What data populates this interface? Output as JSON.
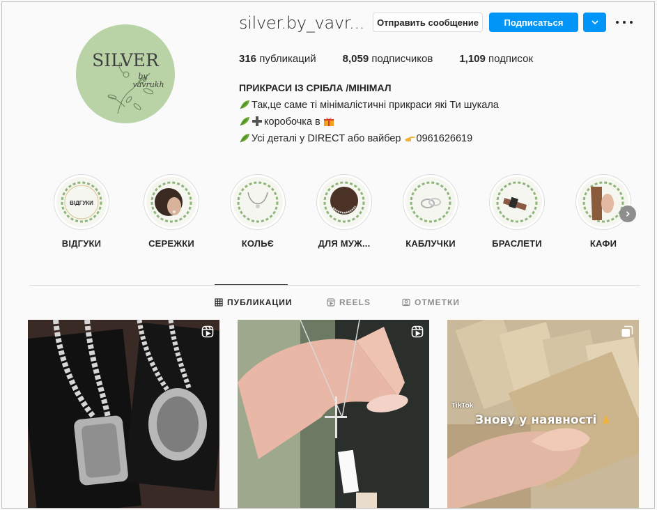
{
  "profile": {
    "username": "silver.by_vavr...",
    "avatar_text": "SILVER",
    "avatar_subtext": "by vavrukh",
    "message_button": "Отправить сообщение",
    "follow_button": "Подписаться",
    "stats": {
      "posts_count": "316",
      "posts_label": "публикаций",
      "followers_count": "8,059",
      "followers_label": "подписчиков",
      "following_count": "1,109",
      "following_label": "подписок"
    },
    "bio": {
      "name": "ПРИКРАСИ ІЗ СРІБЛА /МІНІМАЛ",
      "line1": "Так,це саме ті мінімалістичні прикраси які Ти шукала",
      "line2": "коробочка в",
      "line3a": "Усі деталі у DIRECT або вайбер",
      "line3b": "0961626619"
    }
  },
  "highlights": [
    {
      "label": "ВІДГУКИ",
      "cover_text": "ВІДГУКИ"
    },
    {
      "label": "СЕРЕЖКИ"
    },
    {
      "label": "КОЛЬЄ"
    },
    {
      "label": "ДЛЯ МУЖ..."
    },
    {
      "label": "КАБЛУЧКИ"
    },
    {
      "label": "БРАСЛЕТИ"
    },
    {
      "label": "КАФИ"
    }
  ],
  "tabs": {
    "posts": "ПУБЛИКАЦИИ",
    "reels": "REELS",
    "tagged": "ОТМЕТКИ"
  },
  "posts": [
    {
      "type": "reel"
    },
    {
      "type": "reel"
    },
    {
      "type": "carousel",
      "overlay_text": "Знову у наявності",
      "watermark": "TikTok"
    }
  ],
  "colors": {
    "accent": "#0095f6",
    "avatar_bg": "#b9d3a6"
  }
}
